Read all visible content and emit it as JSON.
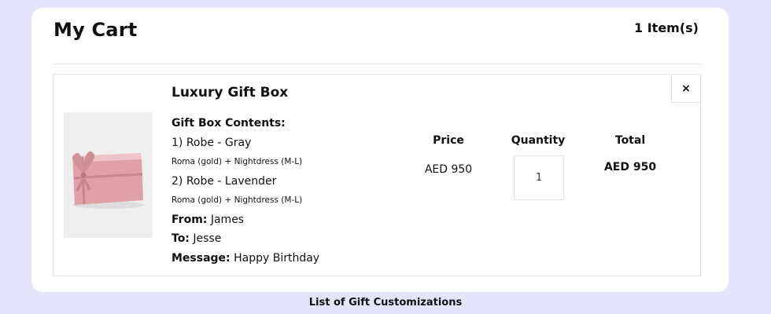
{
  "cart": {
    "title": "My Cart",
    "item_count": "1 Item(s)"
  },
  "item": {
    "remove_label": "×",
    "name": "Luxury Gift Box",
    "image_icon": "pink-gift-box-with-ribbon",
    "contents_label": "Gift Box Contents:",
    "contents": [
      {
        "line": "1) Robe - Gray",
        "sub": "Roma (gold) + Nightdress (M-L)"
      },
      {
        "line": "2) Robe - Lavender",
        "sub": "Roma (gold) + Nightdress (M-L)"
      }
    ],
    "from_label": "From:",
    "from_value": "James",
    "to_label": "To:",
    "to_value": "Jesse",
    "message_label": "Message:",
    "message_value": "Happy Birthday"
  },
  "columns": {
    "price": "Price",
    "quantity": "Quantity",
    "total": "Total"
  },
  "values": {
    "price": "AED 950",
    "quantity": "1",
    "total": "AED 950"
  },
  "caption": "List of Gift Customizations",
  "colors": {
    "background": "#e4e4fb",
    "card": "#ffffff",
    "gift_box": "#e6aeb3"
  }
}
